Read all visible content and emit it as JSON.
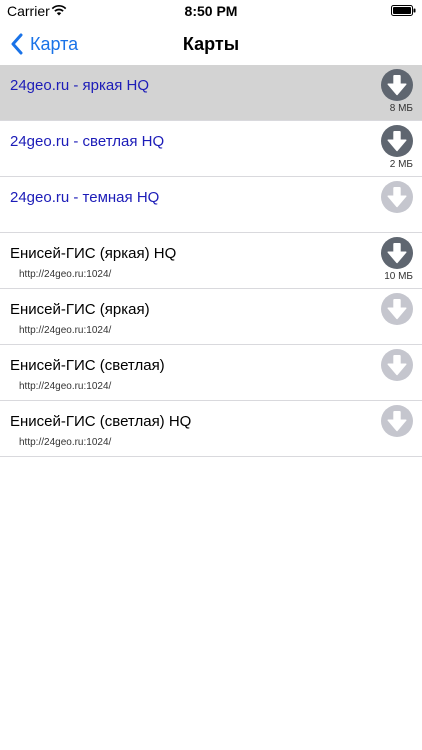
{
  "status_bar": {
    "carrier": "Carrier",
    "time": "8:50 PM"
  },
  "nav": {
    "back_label": "Карта",
    "title": "Карты"
  },
  "colors": {
    "accent": "#1a73e8",
    "link": "#1c1cb8",
    "download_active": "#5f6670",
    "download_inactive": "#c5c6ce",
    "selected_row": "#d3d3d3"
  },
  "maps": [
    {
      "title": "24geo.ru - яркая HQ",
      "subtitle": "",
      "size": "8 МБ",
      "state": "available",
      "link": true,
      "selected": true
    },
    {
      "title": "24geo.ru - светлая HQ",
      "subtitle": "",
      "size": "2 МБ",
      "state": "available",
      "link": true,
      "selected": false
    },
    {
      "title": "24geo.ru - темная HQ",
      "subtitle": "",
      "size": "",
      "state": "disabled",
      "link": true,
      "selected": false
    },
    {
      "title": "Енисей-ГИС (яркая) HQ",
      "subtitle": "http://24geo.ru:1024/",
      "size": "10 МБ",
      "state": "available",
      "link": false,
      "selected": false
    },
    {
      "title": "Енисей-ГИС (яркая)",
      "subtitle": "http://24geo.ru:1024/",
      "size": "",
      "state": "disabled",
      "link": false,
      "selected": false
    },
    {
      "title": "Енисей-ГИС (светлая)",
      "subtitle": "http://24geo.ru:1024/",
      "size": "",
      "state": "disabled",
      "link": false,
      "selected": false
    },
    {
      "title": "Енисей-ГИС (светлая) HQ",
      "subtitle": "http://24geo.ru:1024/",
      "size": "",
      "state": "disabled",
      "link": false,
      "selected": false
    }
  ]
}
